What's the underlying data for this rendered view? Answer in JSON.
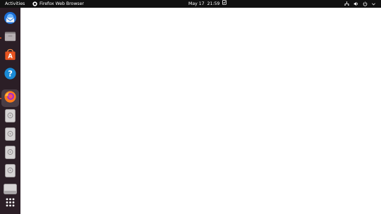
{
  "topbar": {
    "activities_label": "Activities",
    "app_title": "Firefox Web Browser",
    "date": "May 17",
    "time": "21:59"
  },
  "dock": {
    "items": [
      {
        "name": "thunderbird-icon",
        "running": false
      },
      {
        "name": "files-icon",
        "running": true
      },
      {
        "name": "software-center-icon",
        "running": false
      },
      {
        "name": "help-icon",
        "running": false
      },
      {
        "name": "firefox-icon",
        "running": true
      },
      {
        "name": "drive-icon",
        "running": false
      },
      {
        "name": "drive-icon",
        "running": false
      },
      {
        "name": "drive-icon",
        "running": false
      },
      {
        "name": "drive-icon",
        "running": false
      },
      {
        "name": "drive-icon",
        "running": false
      },
      {
        "name": "show-apps-icon",
        "running": false
      }
    ]
  },
  "colors": {
    "topbar": "#111111",
    "dock": "#2b1e26",
    "accent": "#e95420",
    "window": "#ffffff"
  }
}
